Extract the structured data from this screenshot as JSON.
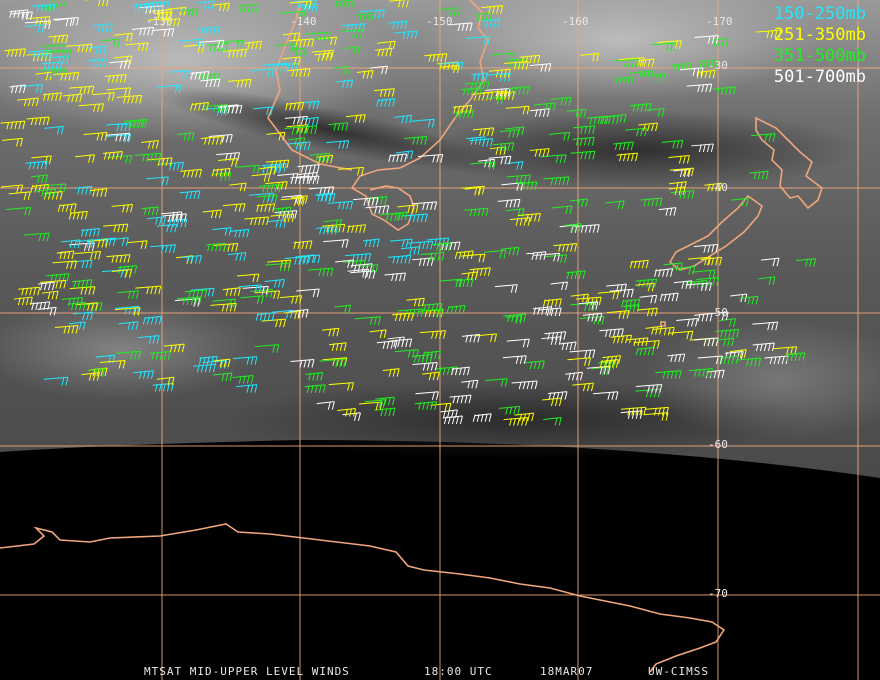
{
  "legend": [
    {
      "label": "150-250mb",
      "color": "#22e8ff"
    },
    {
      "label": "251-350mb",
      "color": "#ffff00"
    },
    {
      "label": "351-500mb",
      "color": "#22ee22"
    },
    {
      "label": "501-700mb",
      "color": "#ffffff"
    }
  ],
  "longitude_labels": [
    "-130",
    "-140",
    "-150",
    "-160",
    "-170"
  ],
  "latitude_labels": [
    "-30",
    "-40",
    "-50",
    "-60",
    "-70"
  ],
  "footer": {
    "product": "MTSAT MID-UPPER LEVEL WINDS",
    "time": "18:00 UTC",
    "date": "18MAR07",
    "source": "UW-CIMSS"
  },
  "colors": {
    "grid": "#f0a67c",
    "coastline": "#f0a67c",
    "space": "#000000"
  }
}
